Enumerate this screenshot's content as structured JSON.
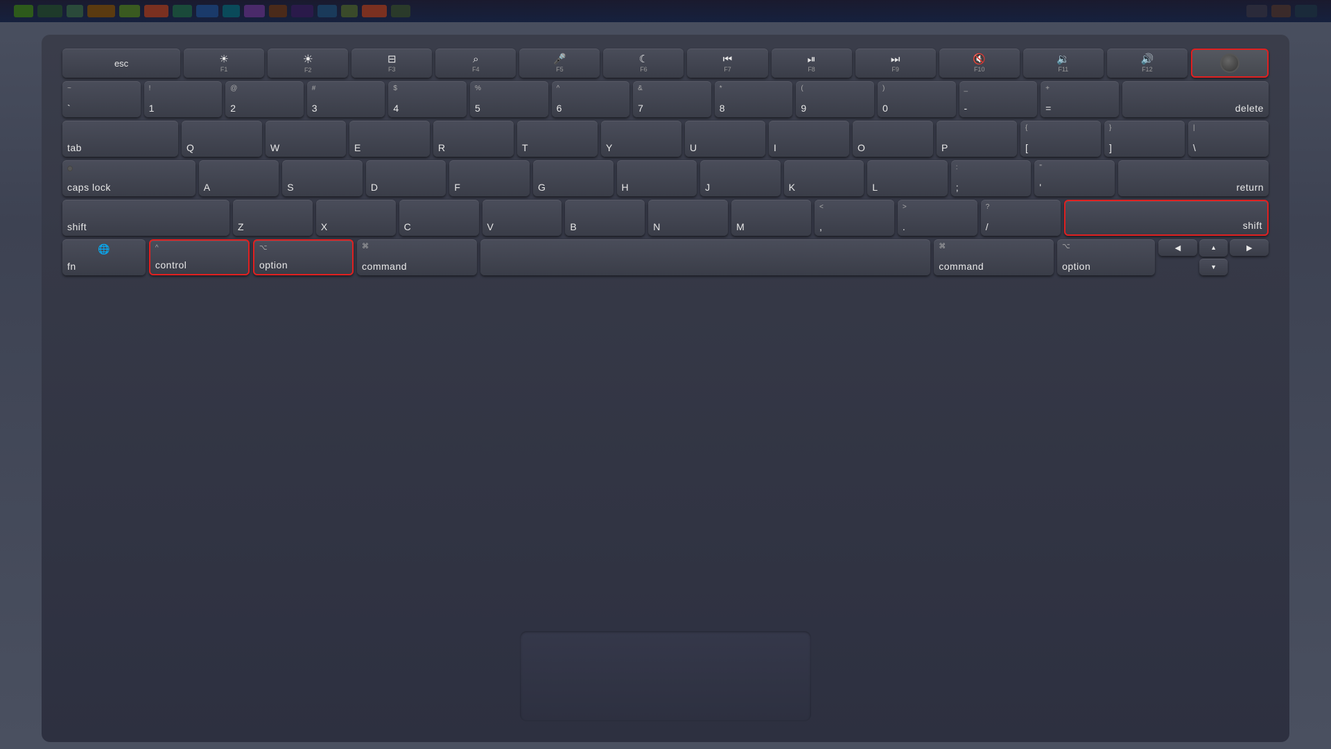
{
  "keyboard": {
    "highlighted_keys": [
      "control",
      "option-left",
      "power",
      "right-shift",
      "option-right"
    ],
    "fn_row": [
      {
        "label": "esc",
        "type": "text"
      },
      {
        "icon": "☀",
        "sub": "F1"
      },
      {
        "icon": "☀",
        "sub": "F2"
      },
      {
        "icon": "⊞",
        "sub": "F3"
      },
      {
        "icon": "🔍",
        "sub": "F4"
      },
      {
        "icon": "🎤",
        "sub": "F5"
      },
      {
        "icon": "☾",
        "sub": "F6"
      },
      {
        "icon": "⏮",
        "sub": "F7"
      },
      {
        "icon": "⏯",
        "sub": "F8"
      },
      {
        "icon": "⏭",
        "sub": "F9"
      },
      {
        "icon": "🔇",
        "sub": "F10"
      },
      {
        "icon": "🔉",
        "sub": "F11"
      },
      {
        "icon": "🔊",
        "sub": "F12"
      }
    ],
    "number_row": [
      {
        "top": "~",
        "main": "`"
      },
      {
        "top": "!",
        "main": "1"
      },
      {
        "top": "@",
        "main": "2"
      },
      {
        "top": "#",
        "main": "3"
      },
      {
        "top": "$",
        "main": "4"
      },
      {
        "top": "%",
        "main": "5"
      },
      {
        "top": "^",
        "main": "6"
      },
      {
        "top": "&",
        "main": "7"
      },
      {
        "top": "*",
        "main": "8"
      },
      {
        "top": "(",
        "main": "9"
      },
      {
        "top": ")",
        "main": "0"
      },
      {
        "top": "_",
        "main": "-"
      },
      {
        "top": "+",
        "main": "="
      },
      {
        "main": "delete",
        "wide": true
      }
    ],
    "qwerty_row": [
      "Q",
      "W",
      "E",
      "R",
      "T",
      "Y",
      "U",
      "I",
      "O",
      "P"
    ],
    "asdf_row": [
      "A",
      "S",
      "D",
      "F",
      "G",
      "H",
      "J",
      "K",
      "L"
    ],
    "zxcv_row": [
      "Z",
      "X",
      "C",
      "V",
      "B",
      "N",
      "M"
    ],
    "bottom_labels": {
      "fn": "fn",
      "globe": "🌐",
      "control": "control",
      "control_icon": "^",
      "option_left": "option",
      "option_icon": "⌥",
      "command_left": "command",
      "command_icon": "⌘",
      "command_right": "command",
      "option_right": "option",
      "shift_right": "shift",
      "return": "return",
      "caps_lock": "caps lock",
      "tab": "tab",
      "shift_left": "shift"
    }
  }
}
